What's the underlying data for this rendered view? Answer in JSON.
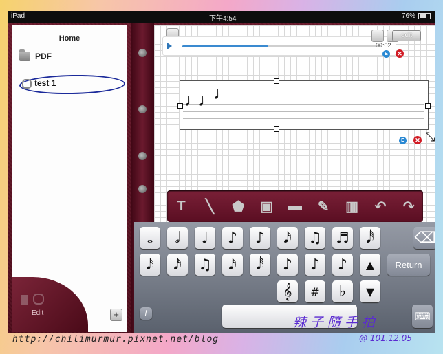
{
  "status_bar": {
    "device": "iPad",
    "time": "下午4:54",
    "battery": "76%"
  },
  "sidebar": {
    "title": "Home",
    "items": [
      {
        "label": "PDF",
        "icon": "folder-icon"
      },
      {
        "label": "test 1",
        "icon": "paperclip-icon"
      }
    ],
    "edit_label": "Edit",
    "add_label": "+"
  },
  "canvas": {
    "edit_label": "edit",
    "audio_time": "00:02",
    "audio_progress": 0.43,
    "badge_e": "E",
    "badge_x": "✕"
  },
  "toolbar": {
    "tools": [
      "text-tool-icon",
      "line-tool-icon",
      "pentagon-tool-icon",
      "camera-tool-icon",
      "rectangle-tool-icon",
      "pen-tool-icon",
      "piano-tool-icon",
      "undo-icon",
      "redo-icon"
    ]
  },
  "keyboard": {
    "row1": [
      "𝅝",
      "𝅗𝅥",
      "♩",
      "♪",
      "♪",
      "𝅘𝅥𝅯",
      "♫",
      "♬",
      "𝅘𝅥𝅰"
    ],
    "row2": [
      "𝅘𝅥𝅯",
      "𝅘𝅥𝅯",
      "♫",
      "𝅘𝅥𝅯",
      "𝅘𝅥𝅰",
      "♪",
      "♪",
      "♪"
    ],
    "row3": [
      "𝄞",
      "#",
      "♭"
    ],
    "delete_label": "⌫",
    "up_label": "▲",
    "down_label": "▼",
    "return_label": "Return",
    "info_label": "i",
    "hide_label": "⌨"
  },
  "watermark": {
    "url": "http://chilimurmur.pixnet.net/blog",
    "signature": "辣子隨手拍",
    "date": "@ 101.12.05"
  },
  "colors": {
    "leather": "#5a0f20",
    "accent_blue": "#2a89d3",
    "delete_red": "#d11b24",
    "signature": "#5a2bd1"
  }
}
